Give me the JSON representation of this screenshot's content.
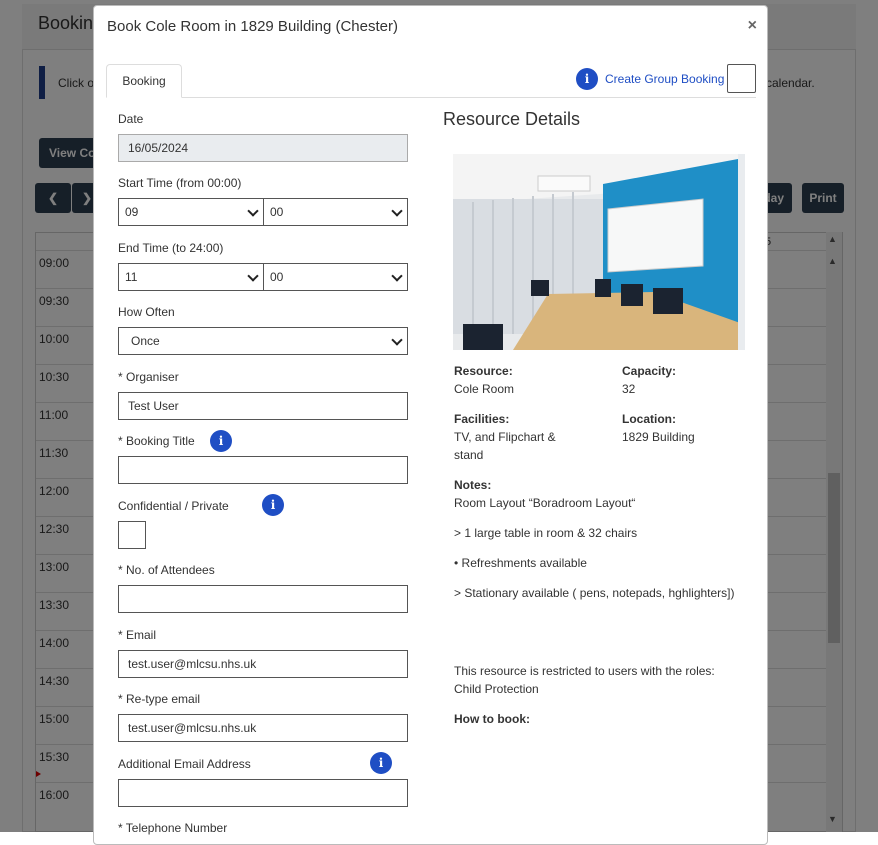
{
  "background": {
    "title": "Bookin",
    "info_text_left": "Click o",
    "info_text_right": "calendar.",
    "view_button": "View Co",
    "prev_icon": "chevron-left-icon",
    "next_icon": "chevron-right-icon",
    "today_button": "day",
    "print_button": "Print",
    "column_header": "5",
    "times": [
      "09:00",
      "09:30",
      "10:00",
      "10:30",
      "11:00",
      "11:30",
      "12:00",
      "12:30",
      "13:00",
      "13:30",
      "14:00",
      "14:30",
      "15:00",
      "15:30",
      "16:00"
    ]
  },
  "modal": {
    "title": "Book Cole Room in 1829 Building (Chester)",
    "close_label": "×",
    "tab_booking": "Booking",
    "info_glyph": "i",
    "create_group_booking": "Create Group Booking"
  },
  "form": {
    "date_label": "Date",
    "date_value": "16/05/2024",
    "start_time_label": "Start Time (from 00:00)",
    "start_hour": "09",
    "start_minute": "00",
    "end_time_label": "End Time (to 24:00)",
    "end_hour": "11",
    "end_minute": "00",
    "how_often_label": "How Often",
    "how_often_value": "Once",
    "organiser_label": "* Organiser",
    "organiser_value": "Test User",
    "booking_title_label": "* Booking Title",
    "booking_title_value": "",
    "confidential_label": "Confidential / Private",
    "attendees_label": "* No. of Attendees",
    "attendees_value": "",
    "email_label": "* Email",
    "email_value": "test.user@mlcsu.nhs.uk",
    "retype_email_label": "* Re-type email",
    "retype_email_value": "test.user@mlcsu.nhs.uk",
    "additional_email_label": "Additional Email Address",
    "additional_email_value": "",
    "telephone_label": "* Telephone Number"
  },
  "resource": {
    "heading": "Resource Details",
    "resource_key": "Resource:",
    "resource_value": "Cole Room",
    "capacity_key": "Capacity:",
    "capacity_value": "32",
    "facilities_key": "Facilities:",
    "facilities_value_1": "TV, and Flipchart &",
    "facilities_value_2": "stand",
    "location_key": "Location:",
    "location_value": "1829 Building",
    "notes_key": "Notes:",
    "notes": [
      "Room Layout “Boradroom Layout“",
      "> 1 large table in room & 32 chairs",
      "• Refreshments available",
      "> Stationary available ( pens, notepads, hghlighters])"
    ],
    "restriction_1": "This resource is restricted to users with the roles:",
    "restriction_2": "Child Protection",
    "how_to_book_key": "How to book:"
  }
}
